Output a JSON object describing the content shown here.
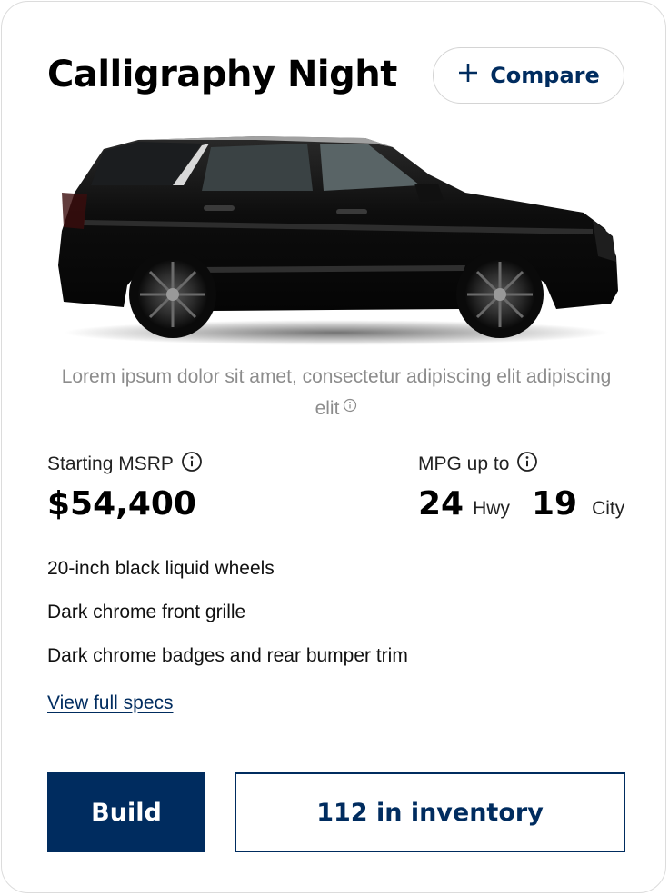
{
  "card": {
    "title": "Calligraphy Night",
    "compare_label": "Compare",
    "image_alt": "Black Palisade Calligraphy Night SUV side view",
    "description": "Lorem ipsum dolor sit amet, consectetur adipiscing elit adipiscing elit",
    "pricing": {
      "label": "Starting MSRP",
      "value": "$54,400"
    },
    "mpg": {
      "label": "MPG up to",
      "hwy_value": "24",
      "hwy_unit": "Hwy",
      "city_value": "19",
      "city_unit": "City"
    },
    "features": [
      "20-inch black liquid wheels",
      "Dark chrome front grille",
      "Dark chrome badges and rear bumper trim"
    ],
    "specs_link": "View full specs",
    "build_label": "Build",
    "inventory_label": "112 in inventory"
  },
  "colors": {
    "brand_navy": "#002c5f",
    "border": "#dcdcdc",
    "muted_text": "#8c8c8c"
  },
  "icons": [
    "plus-icon",
    "info-icon"
  ]
}
